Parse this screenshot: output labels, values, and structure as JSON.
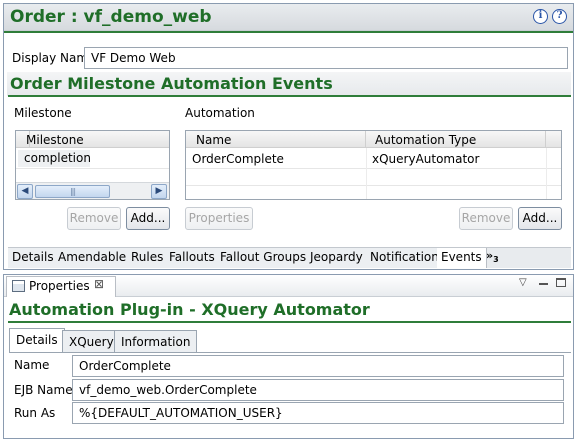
{
  "editor": {
    "title": "Order : vf_demo_web",
    "display_name_label": "Display Nam",
    "display_name_value": "VF Demo Web",
    "section_title": "Order Milestone Automation Events",
    "milestone": {
      "group_label": "Milestone",
      "column_header": "Milestone",
      "rows": [
        "completion"
      ],
      "remove_label": "Remove",
      "add_label": "Add..."
    },
    "automation": {
      "group_label": "Automation",
      "columns": [
        "Name",
        "Automation Type"
      ],
      "rows": [
        {
          "name": "OrderComplete",
          "type": "xQueryAutomator"
        }
      ],
      "properties_label": "Properties",
      "remove_label": "Remove",
      "add_label": "Add..."
    },
    "tabs": [
      "Details",
      "Amendable",
      "Rules",
      "Fallouts",
      "Fallout Groups",
      "Jeopardy",
      "Notification",
      "Events"
    ],
    "active_tab": "Events",
    "overflow_label": "»",
    "overflow_count": "3"
  },
  "properties": {
    "view_title": "Properties",
    "heading": "Automation Plug-in - XQuery Automator",
    "tabs": [
      "Details",
      "XQuery",
      "Information"
    ],
    "active_tab": "Details",
    "fields": {
      "name_label": "Name",
      "name_value": "OrderComplete",
      "ejb_label": "EJB Name",
      "ejb_value": "vf_demo_web.OrderComplete",
      "runas_label": "Run As",
      "runas_value": "%{DEFAULT_AUTOMATION_USER}"
    }
  },
  "icons": {
    "info": "info-icon",
    "help": "help-icon",
    "properties": "properties-view-icon",
    "close": "close-icon",
    "view_menu": "view-menu-icon",
    "minimize": "minimize-icon",
    "maximize": "maximize-icon"
  },
  "colors": {
    "title_green": "#1f6e28",
    "rule_green": "#2f7d3a"
  }
}
